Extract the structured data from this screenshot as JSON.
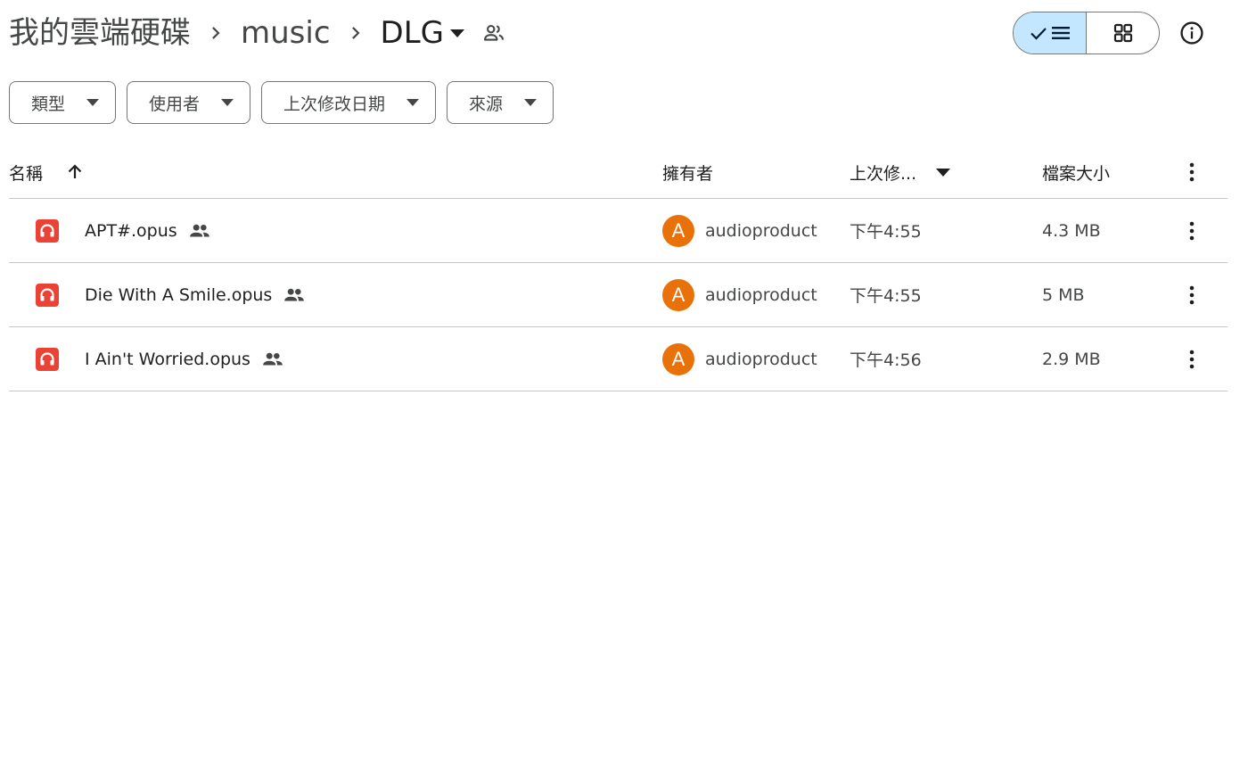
{
  "breadcrumb": {
    "root": "我的雲端硬碟",
    "middle": "music",
    "current": "DLG"
  },
  "filters": [
    {
      "label": "類型"
    },
    {
      "label": "使用者"
    },
    {
      "label": "上次修改日期"
    },
    {
      "label": "來源"
    }
  ],
  "table": {
    "columns": {
      "name": "名稱",
      "owner": "擁有者",
      "modified": "上次修...",
      "size": "檔案大小"
    },
    "rows": [
      {
        "name": "APT#.opus",
        "owner_initial": "A",
        "owner": "audioproduct",
        "modified": "下午4:55",
        "size": "4.3 MB"
      },
      {
        "name": "Die With A Smile.opus",
        "owner_initial": "A",
        "owner": "audioproduct",
        "modified": "下午4:55",
        "size": "5 MB"
      },
      {
        "name": "I Ain't Worried.opus",
        "owner_initial": "A",
        "owner": "audioproduct",
        "modified": "下午4:56",
        "size": "2.9 MB"
      }
    ]
  },
  "colors": {
    "accent": "#c2e7ff",
    "file_icon": "#ea4335",
    "avatar": "#e8710a"
  }
}
